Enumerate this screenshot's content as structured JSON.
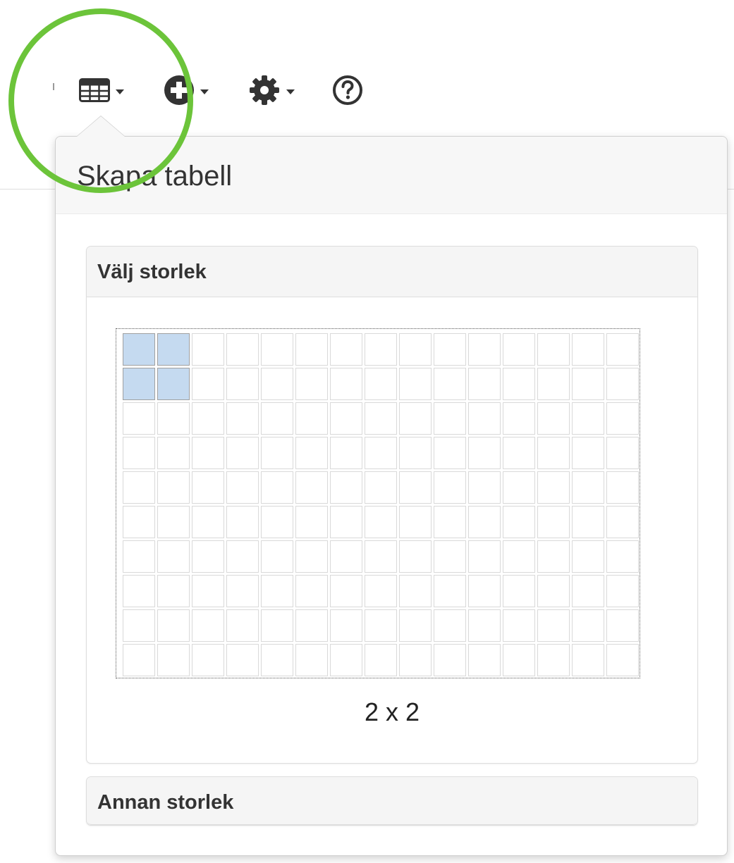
{
  "toolbar": {
    "buttons": [
      {
        "name": "table",
        "icon": "table-icon",
        "has_caret": true
      },
      {
        "name": "insert",
        "icon": "plus-circle-icon",
        "has_caret": true
      },
      {
        "name": "settings",
        "icon": "gear-icon",
        "has_caret": true
      },
      {
        "name": "help",
        "icon": "question-circle-icon",
        "has_caret": false
      }
    ]
  },
  "popover": {
    "title": "Skapa tabell",
    "size_panel": {
      "heading": "Välj storlek",
      "grid": {
        "columns": 15,
        "rows": 10,
        "selected_columns": 2,
        "selected_rows": 2
      },
      "size_readout": "2 x 2"
    },
    "other_panel": {
      "heading": "Annan storlek"
    }
  },
  "colors": {
    "selected_cell": "#c5daf0",
    "highlight_ring": "#6cc43a",
    "panel_heading_bg": "#f5f5f5"
  }
}
